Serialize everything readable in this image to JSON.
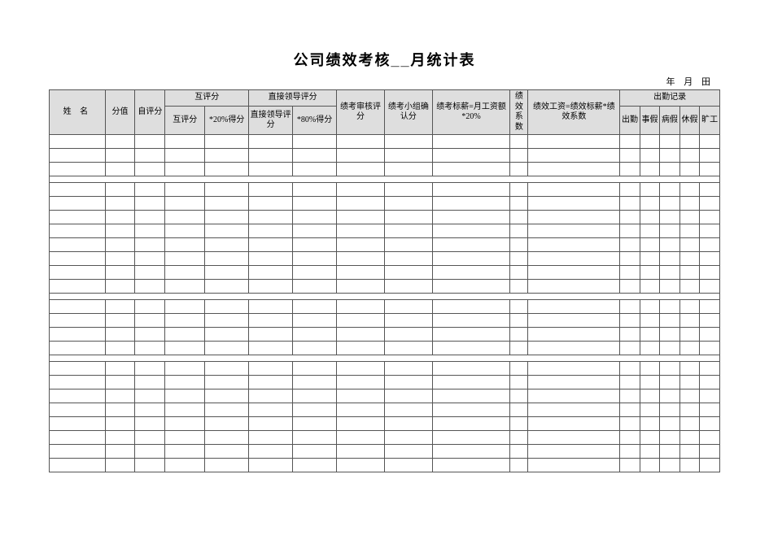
{
  "title": "公司绩效考核__月统计表",
  "dateline": "年   月   田",
  "header": {
    "name": "姓  名",
    "score_value": "分值",
    "self_score": "自评分",
    "peer_group": "互评分",
    "peer_sub1": "互评分",
    "peer_sub2": "*20%得分",
    "leader_group": "直接领导评分",
    "leader_sub1": "直接领导评分",
    "leader_sub2": "*80%得分",
    "review_score": "绩考审核评分",
    "group_confirm": "绩考小组确认分",
    "formula_salary": "绩考标薪=月工资额*20%",
    "coefficient": "绩效系数",
    "formula_wage": "绩效工资=绩效标薪*绩效系数",
    "attendance_group": "出勤记录",
    "att_chuqin": "出勤",
    "att_shijia": "事假",
    "att_bingjia": "病假",
    "att_xiujia": "休假",
    "att_kuanggong": "旷工"
  },
  "body_rows": 23,
  "break_after": [
    3,
    11,
    15
  ]
}
